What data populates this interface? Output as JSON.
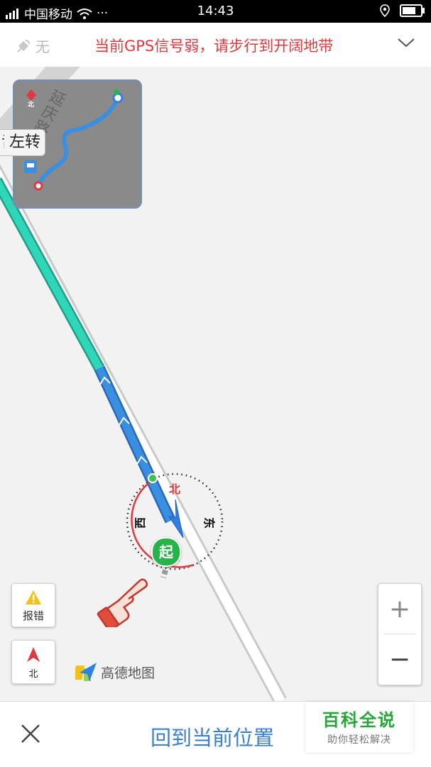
{
  "statusbar": {
    "carrier": "中国移动",
    "signal": "4G",
    "dots": "···",
    "time": "14:43"
  },
  "gps": {
    "signal_label": "无",
    "message": "当前GPS信号弱，请步行到开阔地带"
  },
  "map": {
    "road_name": "延庆路",
    "turn_tip_prefix": "舌",
    "turn_tip": "左转",
    "compass": {
      "north": "北",
      "east": "东",
      "south": "南",
      "west": "西"
    },
    "start_label": "起",
    "report_label": "报错",
    "north_label": "北",
    "minimap_station_label": "北",
    "brand": "高德地图"
  },
  "zoom": {
    "in": "+",
    "out": "−"
  },
  "bottom": {
    "back_label": "回到当前位置"
  },
  "watermark": {
    "title": "百科全说",
    "subtitle": "助你轻松解决"
  },
  "colors": {
    "route_blue": "#3a8fe0",
    "route_teal": "#2fd6b7",
    "warning_red": "#e0393e",
    "compass_red": "#e0393e",
    "brand_blue": "#3b7fd0"
  }
}
